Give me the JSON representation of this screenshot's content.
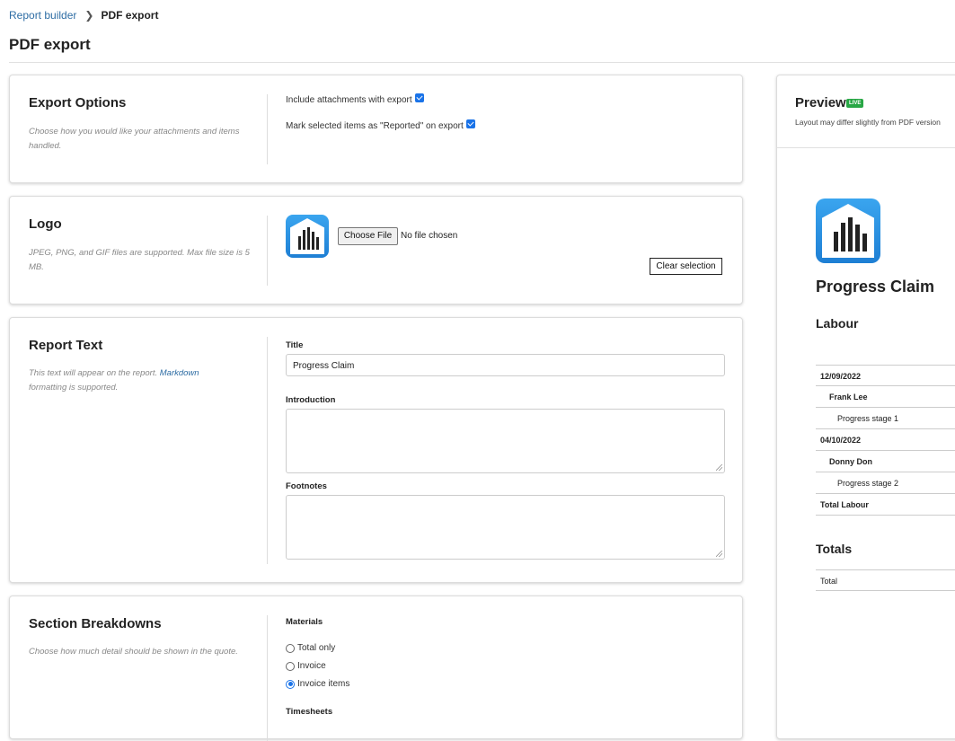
{
  "breadcrumb": {
    "parent": "Report builder",
    "current": "PDF export"
  },
  "page_title": "PDF export",
  "export_options": {
    "heading": "Export Options",
    "description": "Choose how you would like your attachments and items handled.",
    "include_attachments_label": "Include attachments with export",
    "include_attachments_checked": true,
    "mark_reported_label": "Mark selected items as \"Reported\" on export",
    "mark_reported_checked": true
  },
  "logo": {
    "heading": "Logo",
    "description": "JPEG, PNG, and GIF files are supported. Max file size is 5 MB.",
    "choose_file_label": "Choose File",
    "file_status": "No file chosen",
    "clear_label": "Clear selection"
  },
  "report_text": {
    "heading": "Report Text",
    "description_prefix": "This text will appear on the report.",
    "description_link": "Markdown",
    "description_suffix": "formatting is supported.",
    "title_label": "Title",
    "title_value": "Progress Claim",
    "introduction_label": "Introduction",
    "introduction_value": "",
    "footnotes_label": "Footnotes",
    "footnotes_value": ""
  },
  "section_breakdowns": {
    "heading": "Section Breakdowns",
    "description": "Choose how much detail should be shown in the quote.",
    "materials_label": "Materials",
    "materials_options": [
      "Total only",
      "Invoice",
      "Invoice items"
    ],
    "materials_selected": "Invoice items",
    "timesheets_label": "Timesheets"
  },
  "preview": {
    "title": "Preview",
    "badge": "LIVE",
    "subtitle": "Layout may differ slightly from PDF version",
    "document_title": "Progress Claim",
    "labour_heading": "Labour",
    "labour_rows": [
      "12/09/2022",
      "Frank Lee",
      "Progress stage 1",
      "04/10/2022",
      "Donny Don",
      "Progress stage 2",
      "Total Labour"
    ],
    "totals_heading": "Totals",
    "totals_rows": [
      "Total"
    ]
  },
  "colors": {
    "accent": "#1a73e8",
    "link": "#2e6da4",
    "live_badge": "#28a745",
    "logo": "#2b8fe3"
  }
}
